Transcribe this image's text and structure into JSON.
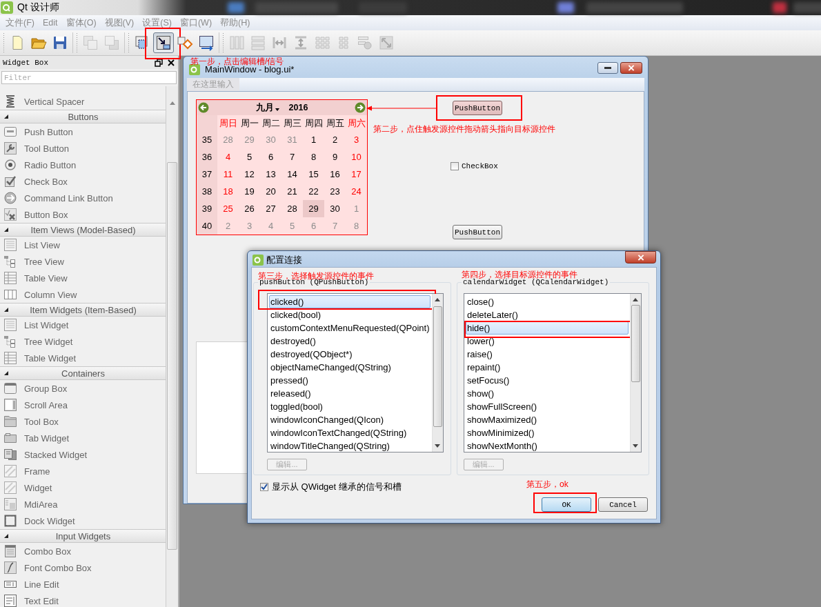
{
  "app": {
    "title": "Qt 设计师"
  },
  "menu": [
    "文件(F)",
    "Edit",
    "窗体(O)",
    "视图(V)",
    "设置(S)",
    "窗口(W)",
    "帮助(H)"
  ],
  "toolbar_groups": [
    {
      "tools": [
        {
          "kind": "new",
          "selected": false,
          "disabled": false
        },
        {
          "kind": "open",
          "selected": false,
          "disabled": false
        },
        {
          "kind": "save",
          "selected": false,
          "disabled": false
        }
      ]
    },
    {
      "tools": [
        {
          "kind": "send_back",
          "selected": false,
          "disabled": true
        },
        {
          "kind": "bring_front",
          "selected": false,
          "disabled": true
        }
      ]
    },
    {
      "tools": [
        {
          "kind": "edit_widgets",
          "selected": false,
          "disabled": false
        },
        {
          "kind": "edit_signals",
          "selected": true,
          "disabled": false
        },
        {
          "kind": "edit_buddies",
          "selected": false,
          "disabled": false
        },
        {
          "kind": "edit_tab_order",
          "selected": false,
          "disabled": false
        }
      ]
    },
    {
      "tools": [
        {
          "kind": "layout_h",
          "selected": false,
          "disabled": true
        },
        {
          "kind": "layout_v",
          "selected": false,
          "disabled": true
        },
        {
          "kind": "split_h",
          "selected": false,
          "disabled": true
        },
        {
          "kind": "split_v",
          "selected": false,
          "disabled": true
        },
        {
          "kind": "layout_grid",
          "selected": false,
          "disabled": true
        },
        {
          "kind": "layout_form",
          "selected": false,
          "disabled": true
        },
        {
          "kind": "break_layout",
          "selected": false,
          "disabled": true
        },
        {
          "kind": "adjust_size",
          "selected": false,
          "disabled": true
        }
      ]
    }
  ],
  "widget_box": {
    "title": "Widget Box",
    "filter_placeholder": "Filter",
    "items": [
      {
        "kind": "widget",
        "label": "Vertical Spacer"
      },
      {
        "kind": "category",
        "label": "Buttons",
        "expanded": true
      },
      {
        "kind": "widget",
        "label": "Push Button"
      },
      {
        "kind": "widget",
        "label": "Tool Button"
      },
      {
        "kind": "widget",
        "label": "Radio Button"
      },
      {
        "kind": "widget",
        "label": "Check Box"
      },
      {
        "kind": "widget",
        "label": "Command Link Button"
      },
      {
        "kind": "widget",
        "label": "Button Box"
      },
      {
        "kind": "category",
        "label": "Item Views (Model-Based)",
        "expanded": true
      },
      {
        "kind": "widget",
        "label": "List View"
      },
      {
        "kind": "widget",
        "label": "Tree View"
      },
      {
        "kind": "widget",
        "label": "Table View"
      },
      {
        "kind": "widget",
        "label": "Column View"
      },
      {
        "kind": "category",
        "label": "Item Widgets (Item-Based)",
        "expanded": true
      },
      {
        "kind": "widget",
        "label": "List Widget"
      },
      {
        "kind": "widget",
        "label": "Tree Widget"
      },
      {
        "kind": "widget",
        "label": "Table Widget"
      },
      {
        "kind": "category",
        "label": "Containers",
        "expanded": true
      },
      {
        "kind": "widget",
        "label": "Group Box"
      },
      {
        "kind": "widget",
        "label": "Scroll Area"
      },
      {
        "kind": "widget",
        "label": "Tool Box"
      },
      {
        "kind": "widget",
        "label": "Tab Widget"
      },
      {
        "kind": "widget",
        "label": "Stacked Widget"
      },
      {
        "kind": "widget",
        "label": "Frame"
      },
      {
        "kind": "widget",
        "label": "Widget"
      },
      {
        "kind": "widget",
        "label": "MdiArea"
      },
      {
        "kind": "widget",
        "label": "Dock Widget"
      },
      {
        "kind": "category",
        "label": "Input Widgets",
        "expanded": true
      },
      {
        "kind": "widget",
        "label": "Combo Box"
      },
      {
        "kind": "widget",
        "label": "Font Combo Box"
      },
      {
        "kind": "widget",
        "label": "Line Edit"
      },
      {
        "kind": "widget",
        "label": "Text Edit"
      }
    ]
  },
  "main_window": {
    "title": "MainWindow - blog.ui*",
    "menu_placeholder": "在这里输入",
    "calendar": {
      "month": "九月",
      "year": "2016",
      "weekdays": [
        {
          "label": "周日",
          "weekend": true
        },
        {
          "label": "周一",
          "weekend": false
        },
        {
          "label": "周二",
          "weekend": false
        },
        {
          "label": "周三",
          "weekend": false
        },
        {
          "label": "周四",
          "weekend": false
        },
        {
          "label": "周五",
          "weekend": false
        },
        {
          "label": "周六",
          "weekend": true
        }
      ],
      "weeks": [
        {
          "number": "35",
          "days": [
            {
              "label": "28",
              "kind": "outside",
              "selected": false
            },
            {
              "label": "29",
              "kind": "outside",
              "selected": false
            },
            {
              "label": "30",
              "kind": "outside",
              "selected": false
            },
            {
              "label": "31",
              "kind": "outside",
              "selected": false
            },
            {
              "label": "1",
              "kind": "normal",
              "selected": false
            },
            {
              "label": "2",
              "kind": "normal",
              "selected": false
            },
            {
              "label": "3",
              "kind": "weekend",
              "selected": false
            }
          ]
        },
        {
          "number": "36",
          "days": [
            {
              "label": "4",
              "kind": "weekend",
              "selected": false
            },
            {
              "label": "5",
              "kind": "normal",
              "selected": false
            },
            {
              "label": "6",
              "kind": "normal",
              "selected": false
            },
            {
              "label": "7",
              "kind": "normal",
              "selected": false
            },
            {
              "label": "8",
              "kind": "normal",
              "selected": false
            },
            {
              "label": "9",
              "kind": "normal",
              "selected": false
            },
            {
              "label": "10",
              "kind": "weekend",
              "selected": false
            }
          ]
        },
        {
          "number": "37",
          "days": [
            {
              "label": "11",
              "kind": "weekend",
              "selected": false
            },
            {
              "label": "12",
              "kind": "normal",
              "selected": false
            },
            {
              "label": "13",
              "kind": "normal",
              "selected": false
            },
            {
              "label": "14",
              "kind": "normal",
              "selected": false
            },
            {
              "label": "15",
              "kind": "normal",
              "selected": false
            },
            {
              "label": "16",
              "kind": "normal",
              "selected": false
            },
            {
              "label": "17",
              "kind": "weekend",
              "selected": false
            }
          ]
        },
        {
          "number": "38",
          "days": [
            {
              "label": "18",
              "kind": "weekend",
              "selected": false
            },
            {
              "label": "19",
              "kind": "normal",
              "selected": false
            },
            {
              "label": "20",
              "kind": "normal",
              "selected": false
            },
            {
              "label": "21",
              "kind": "normal",
              "selected": false
            },
            {
              "label": "22",
              "kind": "normal",
              "selected": false
            },
            {
              "label": "23",
              "kind": "normal",
              "selected": false
            },
            {
              "label": "24",
              "kind": "weekend",
              "selected": false
            }
          ]
        },
        {
          "number": "39",
          "days": [
            {
              "label": "25",
              "kind": "weekend",
              "selected": false
            },
            {
              "label": "26",
              "kind": "normal",
              "selected": false
            },
            {
              "label": "27",
              "kind": "normal",
              "selected": false
            },
            {
              "label": "28",
              "kind": "normal",
              "selected": false
            },
            {
              "label": "29",
              "kind": "normal",
              "selected": true
            },
            {
              "label": "30",
              "kind": "normal",
              "selected": false
            },
            {
              "label": "1",
              "kind": "outside",
              "selected": false
            }
          ]
        },
        {
          "number": "40",
          "days": [
            {
              "label": "2",
              "kind": "outside",
              "selected": false
            },
            {
              "label": "3",
              "kind": "outside",
              "selected": false
            },
            {
              "label": "4",
              "kind": "outside",
              "selected": false
            },
            {
              "label": "5",
              "kind": "outside",
              "selected": false
            },
            {
              "label": "6",
              "kind": "outside",
              "selected": false
            },
            {
              "label": "7",
              "kind": "outside",
              "selected": false
            },
            {
              "label": "8",
              "kind": "outside",
              "selected": false
            }
          ]
        }
      ]
    },
    "source_button": {
      "label": "PushButton",
      "highlighted": true
    },
    "checkbox": {
      "label": "CheckBox",
      "checked": false
    },
    "push_button": {
      "label": "PushButton",
      "highlighted": false
    }
  },
  "dialog": {
    "title": "配置连接",
    "panels": [
      {
        "title": "pushButton (QPushButton)",
        "edit_button": {
          "label": "编辑...",
          "disabled": true
        },
        "items": [
          {
            "label": "clicked()",
            "selected": true
          },
          {
            "label": "clicked(bool)",
            "selected": false
          },
          {
            "label": "customContextMenuRequested(QPoint)",
            "selected": false
          },
          {
            "label": "destroyed()",
            "selected": false
          },
          {
            "label": "destroyed(QObject*)",
            "selected": false
          },
          {
            "label": "objectNameChanged(QString)",
            "selected": false
          },
          {
            "label": "pressed()",
            "selected": false
          },
          {
            "label": "released()",
            "selected": false
          },
          {
            "label": "toggled(bool)",
            "selected": false
          },
          {
            "label": "windowIconChanged(QIcon)",
            "selected": false
          },
          {
            "label": "windowIconTextChanged(QString)",
            "selected": false
          },
          {
            "label": "windowTitleChanged(QString)",
            "selected": false
          }
        ]
      },
      {
        "title": "calendarWidget (QCalendarWidget)",
        "edit_button": {
          "label": "编辑...",
          "disabled": true
        },
        "items": [
          {
            "label": "close()",
            "selected": false
          },
          {
            "label": "deleteLater()",
            "selected": false
          },
          {
            "label": "hide()",
            "selected": true
          },
          {
            "label": "lower()",
            "selected": false
          },
          {
            "label": "raise()",
            "selected": false
          },
          {
            "label": "repaint()",
            "selected": false
          },
          {
            "label": "setFocus()",
            "selected": false
          },
          {
            "label": "show()",
            "selected": false
          },
          {
            "label": "showFullScreen()",
            "selected": false
          },
          {
            "label": "showMaximized()",
            "selected": false
          },
          {
            "label": "showMinimized()",
            "selected": false
          },
          {
            "label": "showNextMonth()",
            "selected": false
          }
        ]
      }
    ],
    "inherited": {
      "label": "显示从 QWidget 继承的信号和槽",
      "checked": true
    },
    "ok": {
      "label": "OK",
      "highlighted": true
    },
    "cancel": {
      "label": "Cancel"
    }
  },
  "annotations": [
    "第一步，点击编辑槽/信号",
    "第二步，点住触发源控件拖动箭头指向目标源控件",
    "第三步，选择触发源控件的事件",
    "第四步，选择目标源控件的事件",
    "第五步，ok"
  ]
}
